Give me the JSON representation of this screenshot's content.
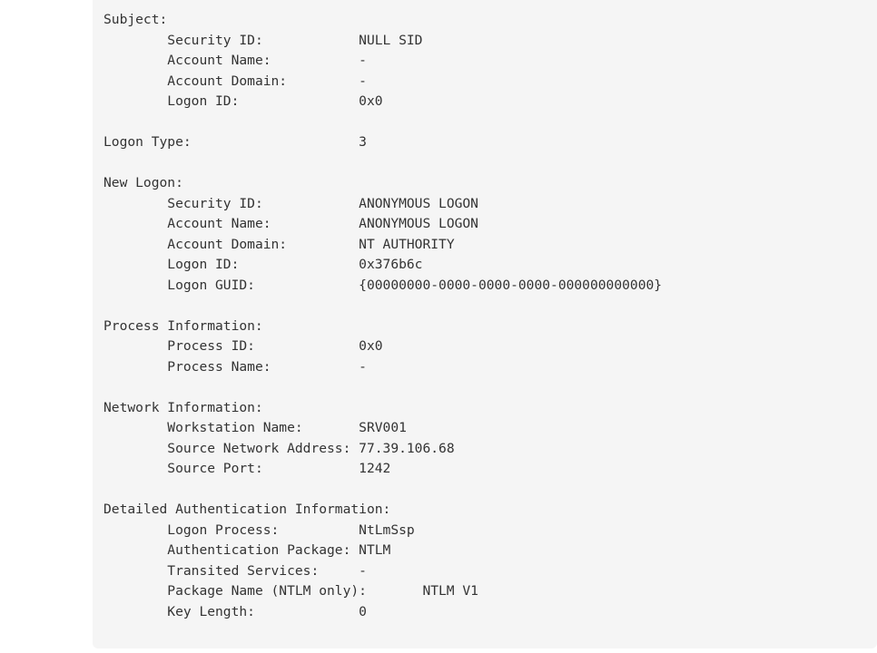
{
  "panel": {
    "background_color": "#f5f5f5",
    "page_background_color": "#ffffff",
    "text_color": "#333333"
  },
  "event_log": {
    "sections": [
      {
        "heading": "Subject:",
        "fields": [
          {
            "label": "Security ID:",
            "value": "NULL SID"
          },
          {
            "label": "Account Name:",
            "value": "-"
          },
          {
            "label": "Account Domain:",
            "value": "-"
          },
          {
            "label": "Logon ID:",
            "value": "0x0"
          }
        ]
      },
      {
        "heading": "Logon Type:",
        "inline_value": "3",
        "fields": []
      },
      {
        "heading": "New Logon:",
        "fields": [
          {
            "label": "Security ID:",
            "value": "ANONYMOUS LOGON"
          },
          {
            "label": "Account Name:",
            "value": "ANONYMOUS LOGON"
          },
          {
            "label": "Account Domain:",
            "value": "NT AUTHORITY"
          },
          {
            "label": "Logon ID:",
            "value": "0x376b6c"
          },
          {
            "label": "Logon GUID:",
            "value": "{00000000-0000-0000-0000-000000000000}"
          }
        ]
      },
      {
        "heading": "Process Information:",
        "fields": [
          {
            "label": "Process ID:",
            "value": "0x0"
          },
          {
            "label": "Process Name:",
            "value": "-"
          }
        ]
      },
      {
        "heading": "Network Information:",
        "fields": [
          {
            "label": "Workstation Name:",
            "value": "SRV001"
          },
          {
            "label": "Source Network Address:",
            "value": "77.39.106.68"
          },
          {
            "label": "Source Port:",
            "value": "1242"
          }
        ]
      },
      {
        "heading": "Detailed Authentication Information:",
        "fields": [
          {
            "label": "Logon Process:",
            "value": "NtLmSsp"
          },
          {
            "label": "Authentication Package:",
            "value": "NTLM"
          },
          {
            "label": "Transited Services:",
            "value": "-"
          },
          {
            "label": "Package Name (NTLM only):",
            "value": "NTLM V1"
          },
          {
            "label": "Key Length:",
            "value": "0"
          }
        ]
      }
    ],
    "raw_text": "Subject:\n\tSecurity ID:\t\tNULL SID\n\tAccount Name:\t\t-\n\tAccount Domain:\t\t-\n\tLogon ID:\t\t0x0\n\nLogon Type:\t\t\t3\n\nNew Logon:\n\tSecurity ID:\t\tANONYMOUS LOGON\n\tAccount Name:\t\tANONYMOUS LOGON\n\tAccount Domain:\t\tNT AUTHORITY\n\tLogon ID:\t\t0x376b6c\n\tLogon GUID:\t\t{00000000-0000-0000-0000-000000000000}\n\nProcess Information:\n\tProcess ID:\t\t0x0\n\tProcess Name:\t\t-\n\nNetwork Information:\n\tWorkstation Name:\tSRV001\n\tSource Network Address:\t77.39.106.68\n\tSource Port:\t\t1242\n\nDetailed Authentication Information:\n\tLogon Process:\t\tNtLmSsp\n\tAuthentication Package:\tNTLM\n\tTransited Services:\t-\n\tPackage Name (NTLM only):\tNTLM V1\n\tKey Length:\t\t0"
  }
}
